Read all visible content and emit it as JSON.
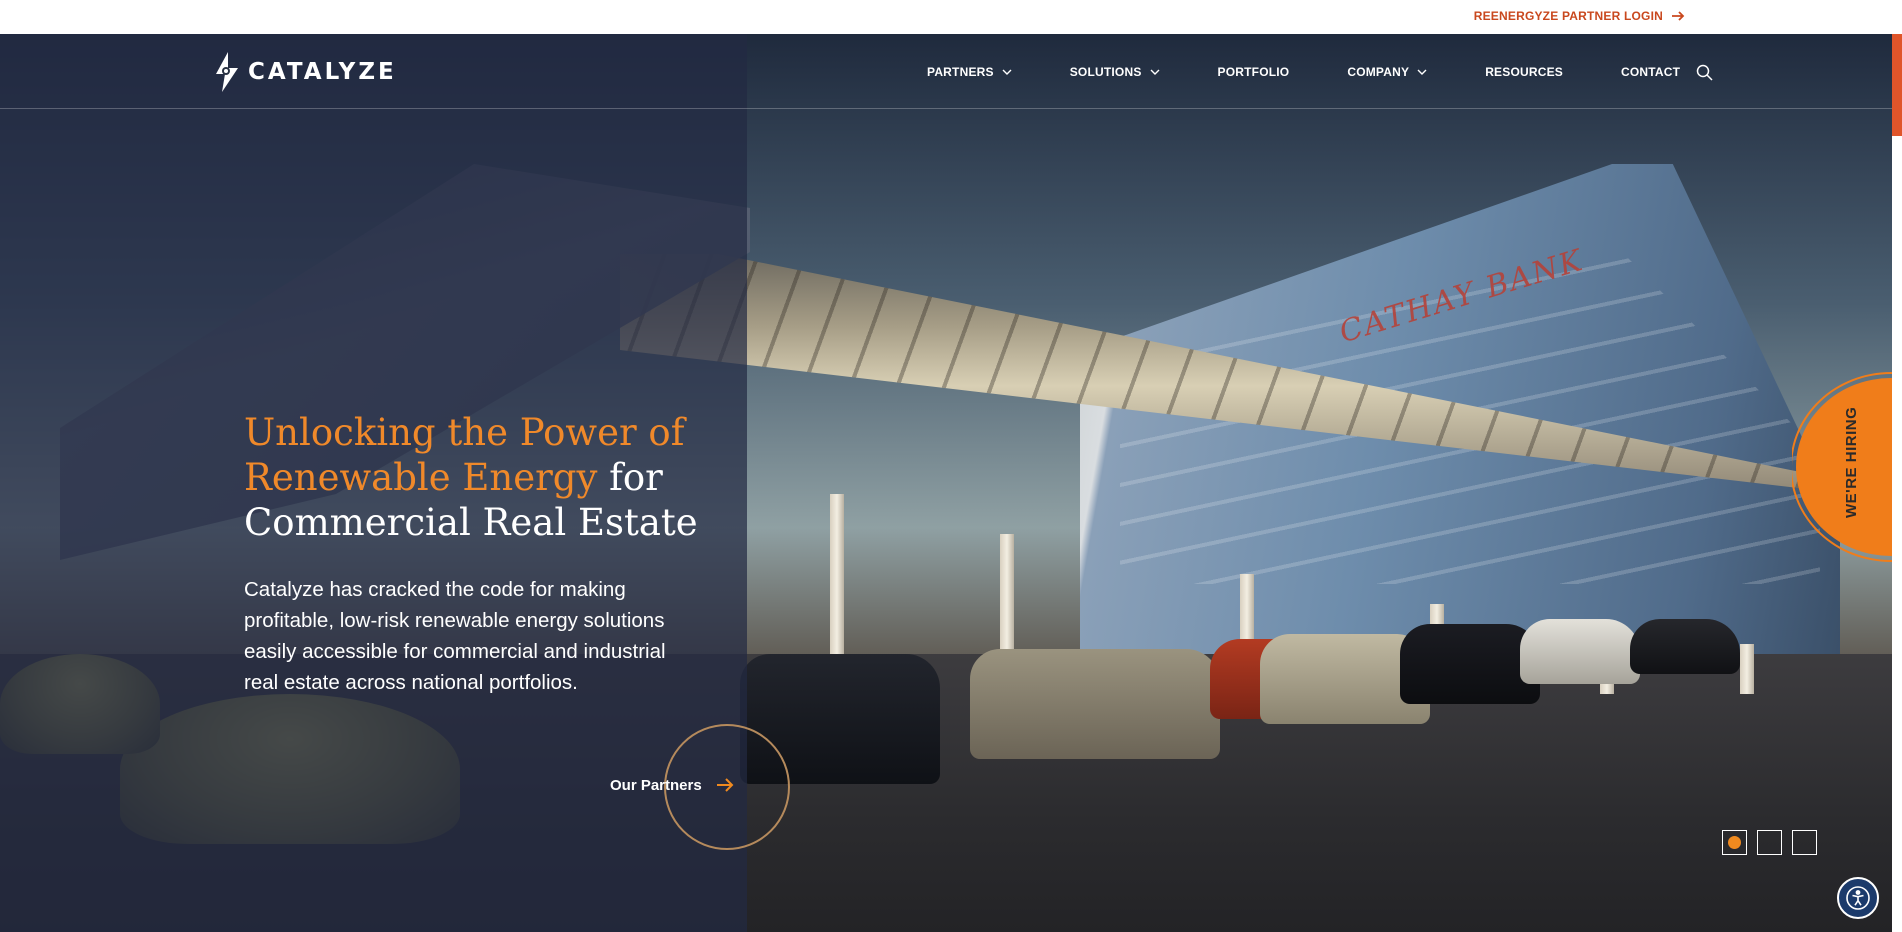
{
  "topbar": {
    "partner_login": "REENERGYZE PARTNER LOGIN"
  },
  "brand": {
    "name": "CATALYZE",
    "accent_color": "#f0892a",
    "link_color": "#c9481e"
  },
  "nav": {
    "items": [
      {
        "label": "PARTNERS",
        "dropdown": true
      },
      {
        "label": "SOLUTIONS",
        "dropdown": true
      },
      {
        "label": "PORTFOLIO",
        "dropdown": false
      },
      {
        "label": "COMPANY",
        "dropdown": true
      },
      {
        "label": "RESOURCES",
        "dropdown": false
      },
      {
        "label": "CONTACT",
        "dropdown": false
      }
    ],
    "search_icon": "search-icon"
  },
  "hero": {
    "headline_accent": "Unlocking the Power of Renewable Energy",
    "headline_rest_1": " for",
    "headline_rest_2": "Commercial Real Estate",
    "subcopy": "Catalyze has cracked the code for making profitable, low-risk renewable energy solutions easily accessible for commercial and industrial real estate across national portfolios.",
    "cta_label": "Our Partners",
    "sign_text": "CATHAY BANK"
  },
  "hiring": {
    "label": "WE'RE HIRING"
  },
  "slider": {
    "count": 3,
    "active_index": 0
  }
}
